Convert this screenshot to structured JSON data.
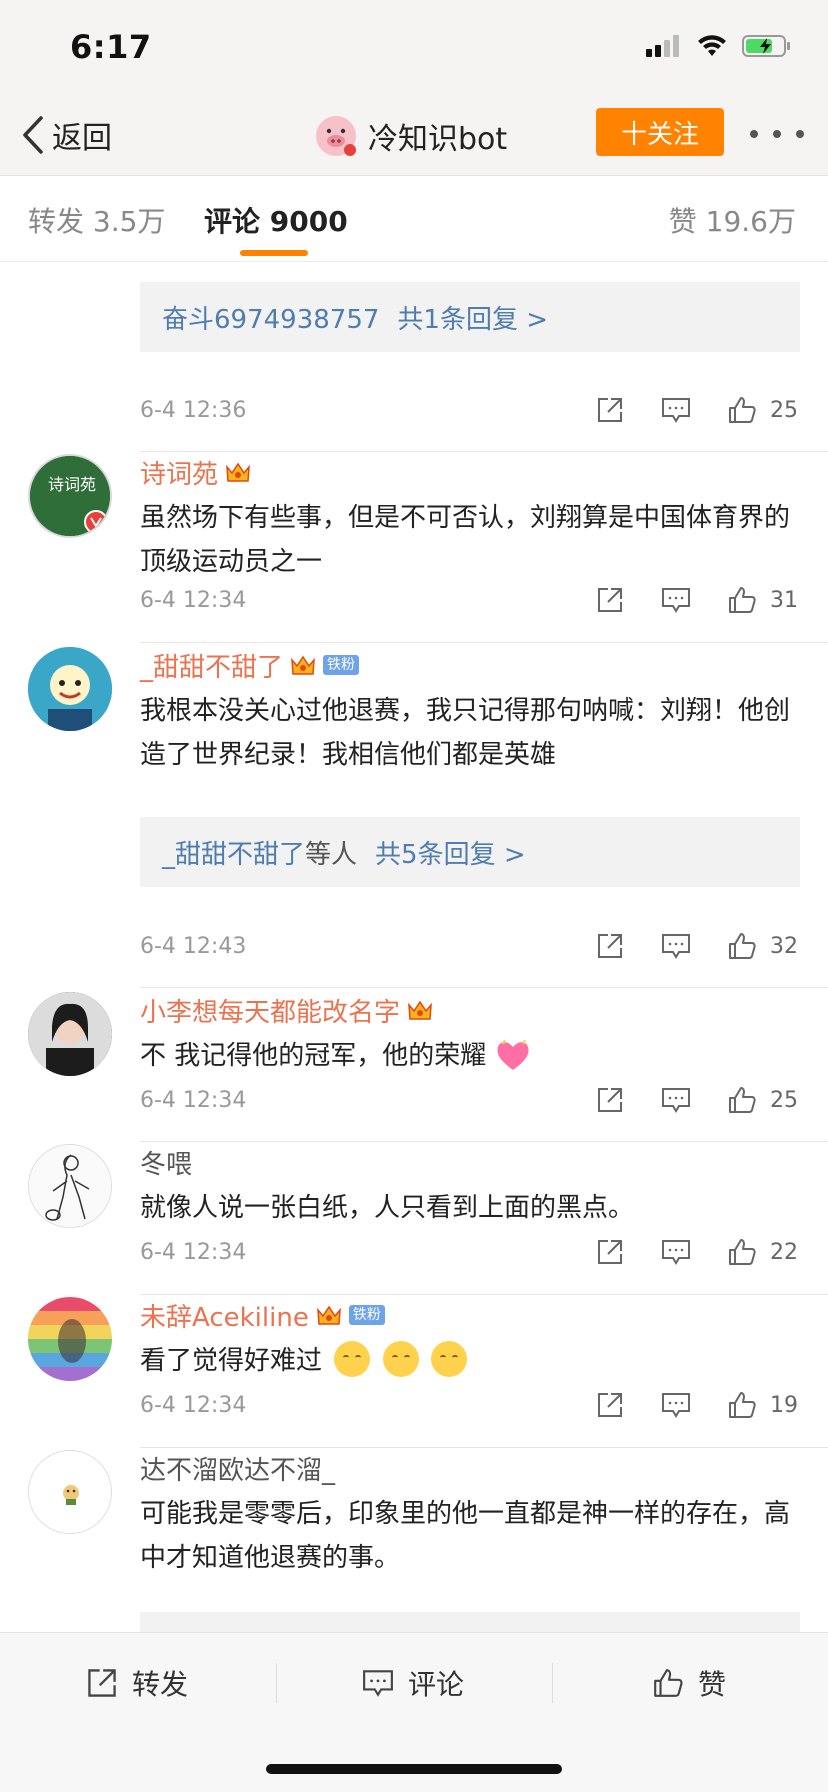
{
  "status_bar": {
    "time": "6:17"
  },
  "nav": {
    "back_label": "返回",
    "title": "冷知识bot",
    "follow_label": "十关注"
  },
  "tabs": {
    "repost": "转发 3.5万",
    "comments": "评论 9000",
    "likes": "赞 19.6万"
  },
  "comments": [
    {
      "reply_user": "奋斗6974938757",
      "reply_count": "共1条回复 >",
      "time": "6-4 12:36",
      "likes": "25"
    },
    {
      "user": "诗词苑",
      "text": "虽然场下有些事，但是不可否认，刘翔算是中国体育界的顶级运动员之一",
      "time": "6-4 12:34",
      "likes": "31",
      "avatar_text": "诗词苑"
    },
    {
      "user": "_甜甜不甜了",
      "badge": "铁粉",
      "text": "我根本没关心过他退赛，我只记得那句呐喊：刘翔！他创造了世界纪录！我相信他们都是英雄",
      "reply_user": "_甜甜不甜了",
      "reply_suffix": "等人",
      "reply_count": "共5条回复 >",
      "time": "6-4 12:43",
      "likes": "32"
    },
    {
      "user": "小李想每天都能改名字",
      "text": "不 我记得他的冠军，他的荣耀",
      "time": "6-4 12:34",
      "likes": "25"
    },
    {
      "user": "冬喂",
      "text": "就像人说一张白纸，人只看到上面的黑点。",
      "time": "6-4 12:34",
      "likes": "22"
    },
    {
      "user": "未辞Acekiline",
      "badge": "铁粉",
      "text": "看了觉得好难过",
      "time": "6-4 12:34",
      "likes": "19"
    },
    {
      "user": "达不溜欧达不溜_",
      "text": "可能我是零零后，印象里的他一直都是神一样的存在，高中才知道他退赛的事。"
    }
  ],
  "bottom_bar": {
    "repost": "转发",
    "comment": "评论",
    "like": "赞"
  },
  "colors": {
    "accent": "#ff8200",
    "username": "#eb7350",
    "link": "#507daf"
  }
}
